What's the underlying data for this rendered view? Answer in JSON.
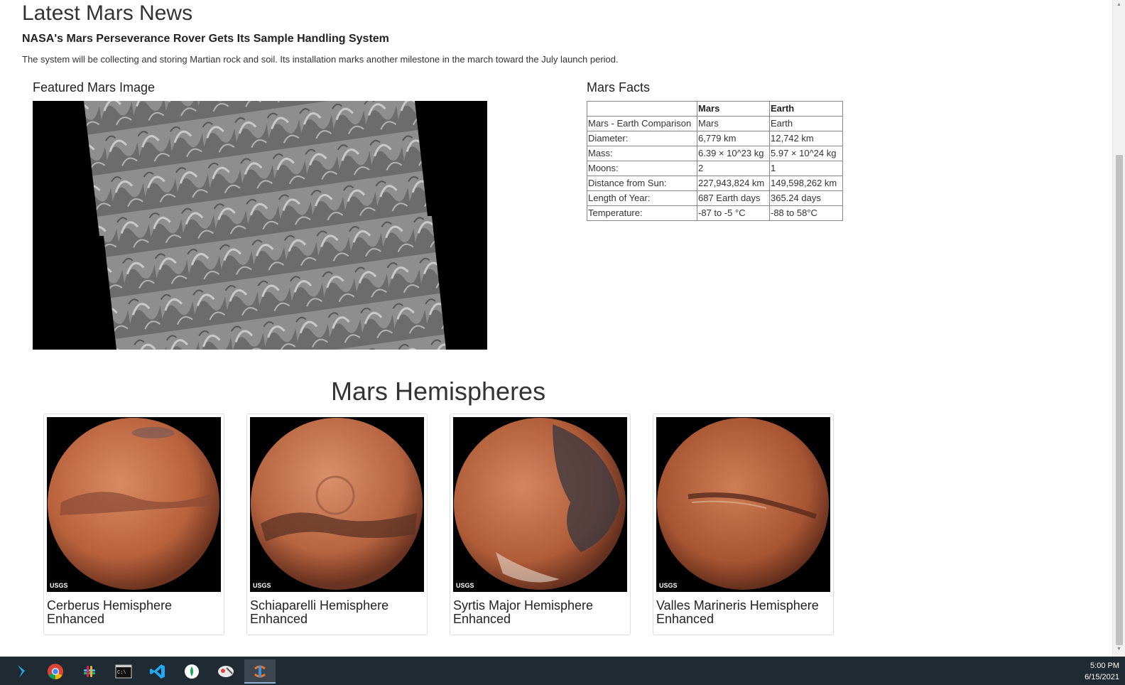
{
  "news": {
    "section_title": "Latest Mars News",
    "headline": "NASA's Mars Perseverance Rover Gets Its Sample Handling System",
    "teaser": "The system will be collecting and storing Martian rock and soil. Its installation marks another milestone in the march toward the July launch period."
  },
  "featured": {
    "heading": "Featured Mars Image"
  },
  "facts": {
    "heading": "Mars Facts",
    "columns": [
      "",
      "Mars",
      "Earth"
    ],
    "rows": [
      [
        "Mars - Earth Comparison",
        "Mars",
        "Earth"
      ],
      [
        "Diameter:",
        "6,779 km",
        "12,742 km"
      ],
      [
        "Mass:",
        "6.39 × 10^23 kg",
        "5.97 × 10^24 kg"
      ],
      [
        "Moons:",
        "2",
        "1"
      ],
      [
        "Distance from Sun:",
        "227,943,824 km",
        "149,598,262 km"
      ],
      [
        "Length of Year:",
        "687 Earth days",
        "365.24 days"
      ],
      [
        "Temperature:",
        "-87 to -5 °C",
        "-88 to 58°C"
      ]
    ]
  },
  "hemispheres": {
    "heading": "Mars Hemispheres",
    "items": [
      {
        "title": "Cerberus Hemisphere Enhanced",
        "watermark": "USGS"
      },
      {
        "title": "Schiaparelli Hemisphere Enhanced",
        "watermark": "USGS"
      },
      {
        "title": "Syrtis Major Hemisphere Enhanced",
        "watermark": "USGS"
      },
      {
        "title": "Valles Marineris Hemisphere Enhanced",
        "watermark": "USGS"
      }
    ]
  },
  "taskbar": {
    "apps": [
      "visual-studio-icon",
      "chrome-icon",
      "slack-icon",
      "terminal-icon",
      "vscode-icon",
      "mongodb-compass-icon",
      "snipping-tool-icon",
      "jupyter-icon"
    ],
    "time": "5:00 PM",
    "date": "6/15/2021"
  },
  "colors": {
    "taskbar_bg": "#1f2a33",
    "mars_orange": "#c0643a",
    "table_border": "#888888"
  }
}
